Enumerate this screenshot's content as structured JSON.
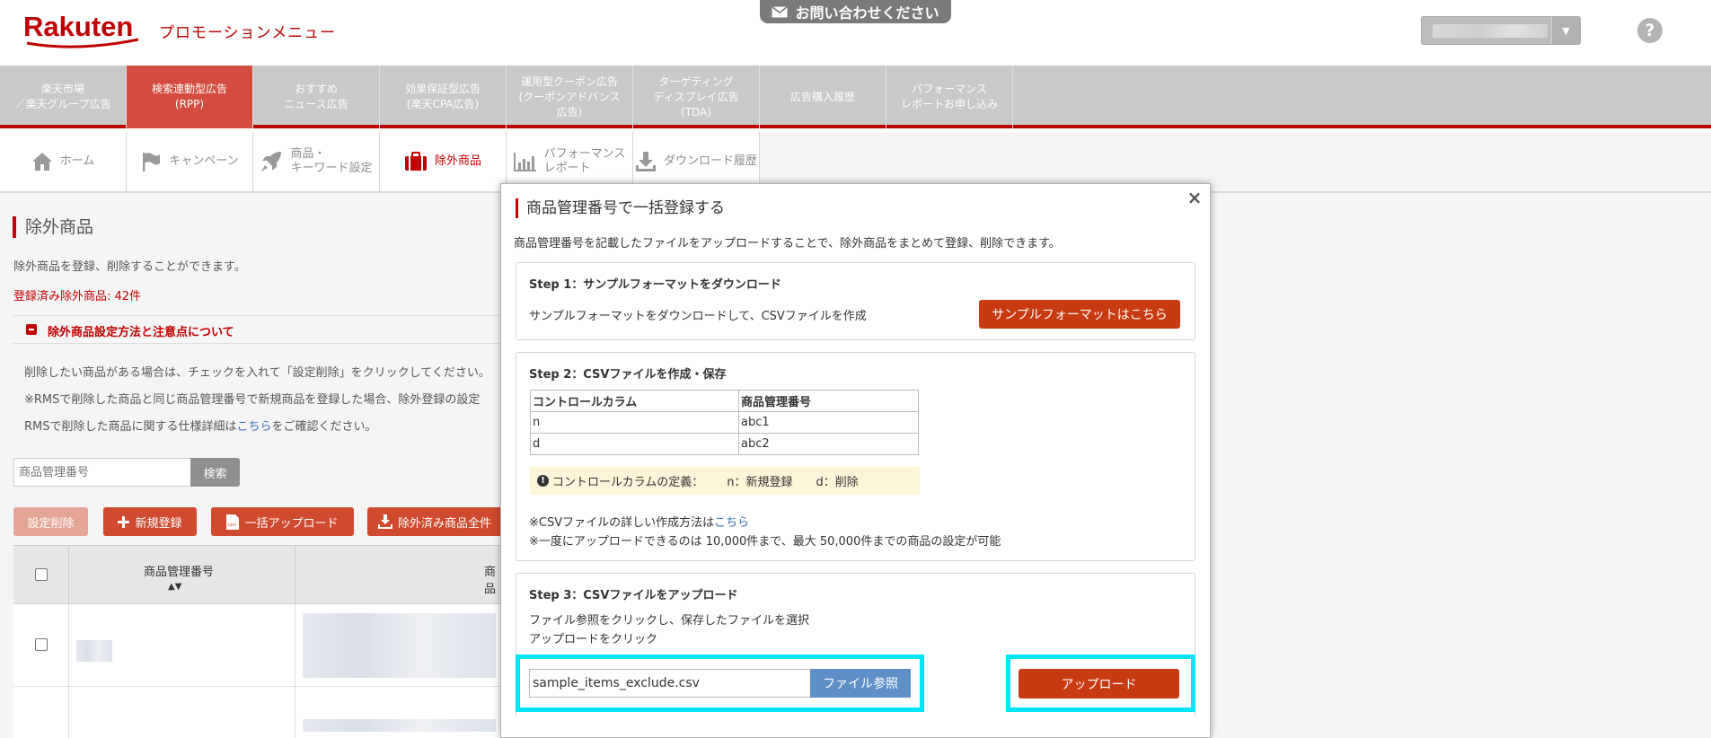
{
  "header": {
    "logo_text": "Rakuten",
    "subtitle": "プロモーションメニュー",
    "contact_label": "お問い合わせください",
    "help_icon": "?"
  },
  "top_nav": [
    {
      "label": "楽天市場\n／楽天グループ広告"
    },
    {
      "label": "検索連動型広告\n(RPP)",
      "active": true
    },
    {
      "label": "おすすめ\nニュース広告"
    },
    {
      "label": "効果保証型広告\n(楽天CPA広告)"
    },
    {
      "label": "運用型クーポン広告\n(クーポンアドバンス\n広告)"
    },
    {
      "label": "ターゲティング\nディスプレイ広告\n(TDA)"
    },
    {
      "label": "広告購入履歴"
    },
    {
      "label": "パフォーマンス\nレポートお申し込み"
    }
  ],
  "sub_nav": [
    {
      "label": "ホーム",
      "icon": "home-icon"
    },
    {
      "label": "キャンペーン",
      "icon": "flag-icon"
    },
    {
      "label": "商品・\nキーワード設定",
      "icon": "rocket-icon"
    },
    {
      "label": "除外商品",
      "icon": "briefcase-icon",
      "active": true
    },
    {
      "label": "パフォーマンス\nレポート",
      "icon": "bar-chart-icon"
    },
    {
      "label": "ダウンロード履歴",
      "icon": "download-icon"
    }
  ],
  "page": {
    "title": "除外商品",
    "description": "除外商品を登録、削除することができます。",
    "registered_count": "登録済み除外商品: 42件",
    "accordion_label": "除外商品設定方法と注意点について",
    "notes": [
      "削除したい商品がある場合は、チェックを入れて「設定削除」をクリックしてください。",
      "※RMSで削除した商品と同じ商品管理番号で新規商品を登録した場合、除外登録の設定",
      "RMSで削除した商品に関する仕様詳細は"
    ],
    "notes_link": "こちら",
    "notes_suffix": "をご確認ください。",
    "search_placeholder": "商品管理番号",
    "search_button": "検索",
    "actions": {
      "delete": "設定削除",
      "new": "新規登録",
      "bulk_upload": "一括アップロード",
      "download_all": "除外済み商品全件"
    },
    "table": {
      "col_item_id": "商品管理番号",
      "col_item_name": "商品",
      "sort_arrows": "▲▼"
    }
  },
  "modal": {
    "title": "商品管理番号で一括登録する",
    "description": "商品管理番号を記載したファイルをアップロードすることで、除外商品をまとめて登録、削除できます。",
    "close_icon": "×",
    "step1": {
      "heading": "Step 1：サンプルフォーマットをダウンロード",
      "text": "サンプルフォーマットをダウンロードして、CSVファイルを作成",
      "button": "サンプルフォーマットはこちら"
    },
    "step2": {
      "heading": "Step 2：CSVファイルを作成・保存",
      "table_headers": [
        "コントロールカラム",
        "商品管理番号"
      ],
      "table_rows": [
        [
          "n",
          "abc1"
        ],
        [
          "d",
          "abc2"
        ]
      ],
      "definition_label": "コントロールカラムの定義：",
      "definition_n": "n：新規登録",
      "definition_d": "d：削除",
      "note1_prefix": "※CSVファイルの詳しい作成方法は",
      "note1_link": "こちら",
      "note2": "※一度にアップロードできるのは 10,000件まで、最大 50,000件までの商品の設定が可能"
    },
    "step3": {
      "heading": "Step 3：CSVファイルをアップロード",
      "text1": "ファイル参照をクリックし、保存したファイルを選択",
      "text2": "アップロードをクリック",
      "file_value": "sample_items_exclude.csv",
      "browse_button": "ファイル参照",
      "upload_button": "アップロード"
    }
  },
  "colors": {
    "brand": "#bf0000",
    "active_tab": "#d44b40",
    "button": "#c83b12",
    "highlight": "#00e5f5",
    "browse": "#5f8fc7"
  }
}
